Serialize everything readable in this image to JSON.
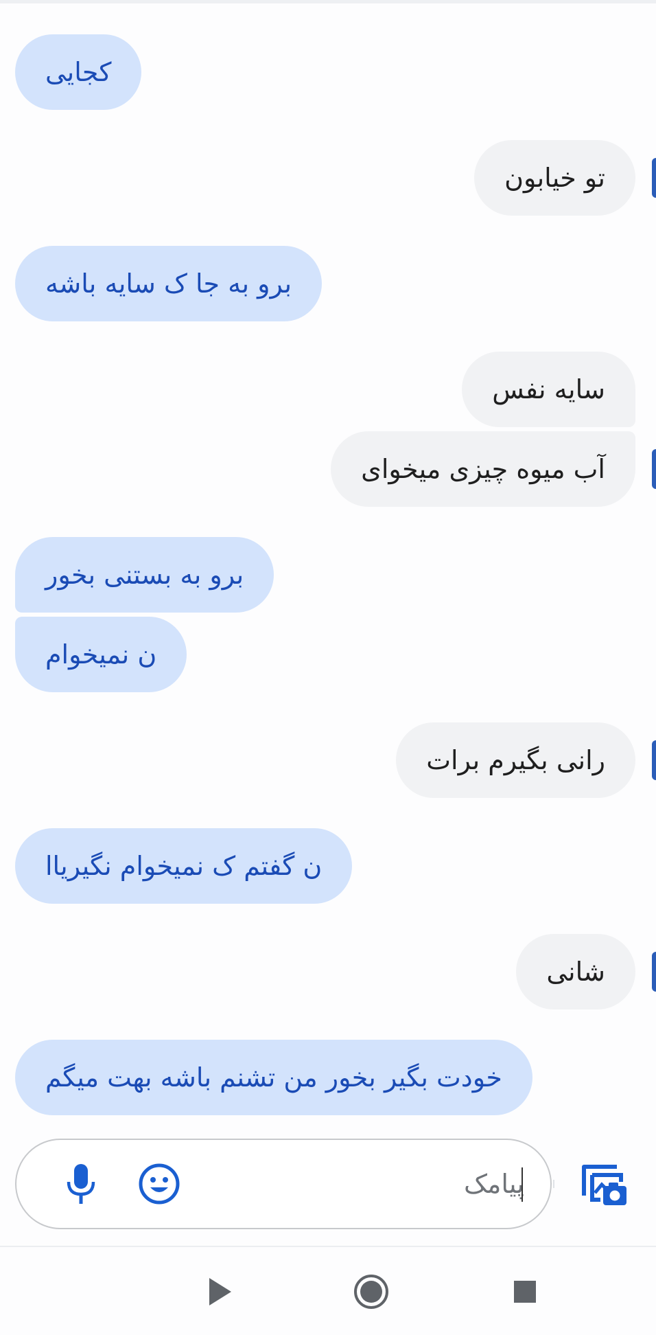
{
  "messages": [
    {
      "text": "کجایی",
      "sender": "me"
    },
    {
      "text": "تو خیابون",
      "sender": "them"
    },
    {
      "text": "برو به جا ک سایه باشه",
      "sender": "me"
    },
    {
      "text": "سایه نفس",
      "sender": "them"
    },
    {
      "text": "آب میوه چیزی میخوای",
      "sender": "them"
    },
    {
      "text": "برو به بستنی بخور",
      "sender": "me"
    },
    {
      "text": "ن نمیخوام",
      "sender": "me"
    },
    {
      "text": "رانی بگیرم برات",
      "sender": "them"
    },
    {
      "text": "ن گفتم ک نمیخوام نگیریاا",
      "sender": "me"
    },
    {
      "text": "شانی",
      "sender": "them"
    },
    {
      "text": "خودت بگیر بخور من تشنم باشه بهت میگم",
      "sender": "me"
    }
  ],
  "composer": {
    "placeholder": "پیامک",
    "icons": {
      "mic": "microphone-icon",
      "emoji": "emoji-icon",
      "gallery": "gallery-camera-icon"
    }
  },
  "navbar": {
    "icons": [
      "back-triangle-icon",
      "home-circle-icon",
      "recents-square-icon"
    ]
  },
  "colors": {
    "outgoing_bubble": "#d3e3fc",
    "outgoing_text": "#1a4bb5",
    "incoming_bubble": "#f1f2f4",
    "incoming_text": "#1f1f1f",
    "accent": "#1a5fd1"
  }
}
